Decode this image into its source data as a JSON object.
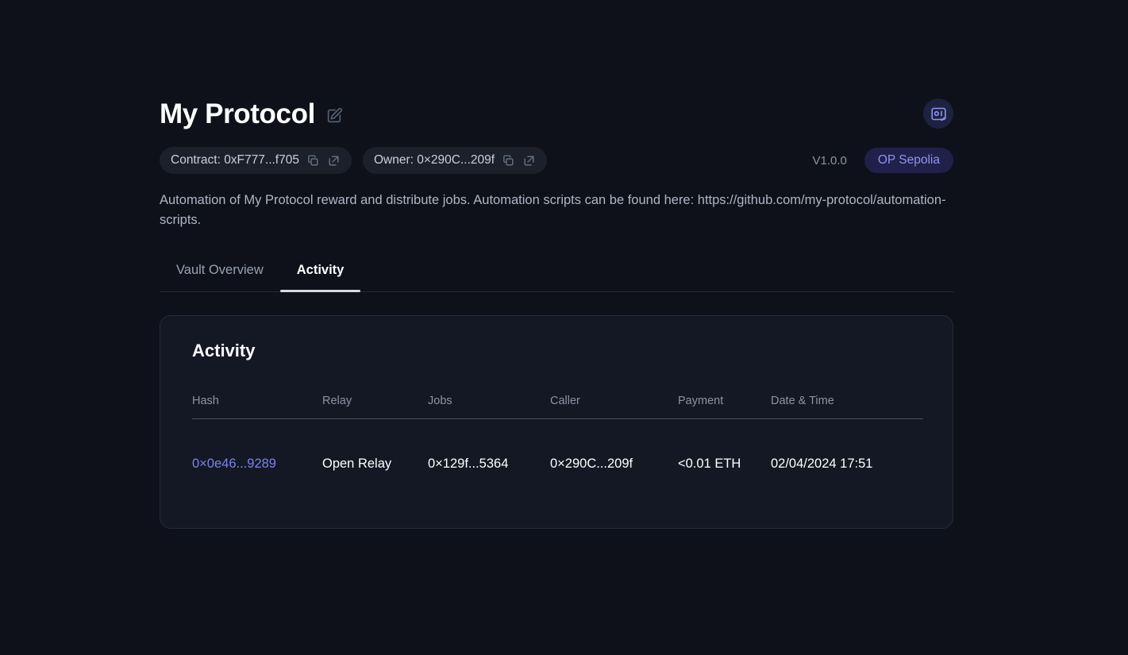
{
  "header": {
    "title": "My Protocol",
    "edit_icon": "edit-pencil-square-icon",
    "vault_status_icon": "vault-check-icon",
    "contract_chip": {
      "label": "Contract: 0xF777...f705",
      "copy_icon": "copy-icon",
      "external_icon": "external-link-icon"
    },
    "owner_chip": {
      "label": "Owner: 0×290C...209f",
      "copy_icon": "copy-icon",
      "external_icon": "external-link-icon"
    },
    "version": "V1.0.0",
    "network": "OP Sepolia",
    "description": "Automation of My Protocol reward and distribute jobs. Automation scripts can be found here: https://github.com/my-protocol/automation-scripts."
  },
  "tabs": [
    {
      "label": "Vault Overview",
      "active": false
    },
    {
      "label": "Activity",
      "active": true
    }
  ],
  "card": {
    "title": "Activity",
    "columns": [
      "Hash",
      "Relay",
      "Jobs",
      "Caller",
      "Payment",
      "Date & Time"
    ],
    "rows": [
      {
        "hash": "0×0e46...9289",
        "relay": "Open Relay",
        "jobs": "0×129f...5364",
        "caller": "0×290C...209f",
        "payment": "<0.01 ETH",
        "datetime": "02/04/2024 17:51"
      }
    ]
  },
  "colors": {
    "background": "#0e111a",
    "card_background": "#141824",
    "accent_link": "#7b83ec",
    "network_badge_bg": "#20204a",
    "network_badge_text": "#8f93f5",
    "tab_underline": "#d6dae3"
  }
}
